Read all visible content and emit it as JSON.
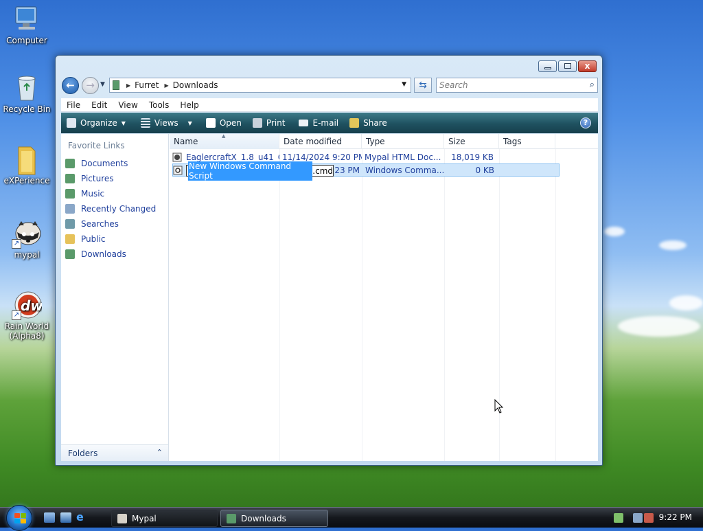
{
  "desktop": {
    "icons": [
      {
        "label": "Computer",
        "icon": "computer-icon"
      },
      {
        "label": "Recycle Bin",
        "icon": "recycle-bin-icon"
      },
      {
        "label": "eXPerience",
        "icon": "folder-icon"
      },
      {
        "label": "mypal",
        "icon": "mypal-raccoon-icon"
      },
      {
        "label": "Rain World (Alpha8)",
        "icon": "rain-world-icon"
      }
    ]
  },
  "window": {
    "title_buttons": {
      "close": "x"
    },
    "address": {
      "breadcrumbs": [
        "Furret",
        "Downloads"
      ],
      "search_placeholder": "Search"
    },
    "menu": [
      "File",
      "Edit",
      "View",
      "Tools",
      "Help"
    ],
    "toolbar": {
      "organize": "Organize",
      "views": "Views",
      "open": "Open",
      "print": "Print",
      "email": "E-mail",
      "share": "Share",
      "help": "?"
    },
    "nav_pane": {
      "title": "Favorite Links",
      "items": [
        "Documents",
        "Pictures",
        "Music",
        "Recently Changed",
        "Searches",
        "Public",
        "Downloads"
      ],
      "folders_label": "Folders"
    },
    "columns": [
      "Name",
      "Date modified",
      "Type",
      "Size",
      "Tags"
    ],
    "files": [
      {
        "name": "EaglercraftX_1.8_u41_O...",
        "date": "11/14/2024 9:20 PM",
        "type": "Mypal HTML Doc...",
        "size": "18,019 KB"
      },
      {
        "name_selected": "New Windows Command Script",
        "name_ext": ".cmd",
        "date_partial": "23 PM",
        "type": "Windows Comma...",
        "size": "0 KB"
      }
    ]
  },
  "taskbar": {
    "tasks": [
      {
        "label": "Mypal",
        "icon": "mypal-raccoon-icon"
      },
      {
        "label": "Downloads",
        "icon": "folder-icon"
      }
    ],
    "clock": "9:22 PM"
  },
  "colors": {
    "toolbar_bg": "#1f5160",
    "link_blue": "#1f3f9c",
    "selection": "#cfe6fb",
    "rename_highlight": "#3399ff"
  }
}
